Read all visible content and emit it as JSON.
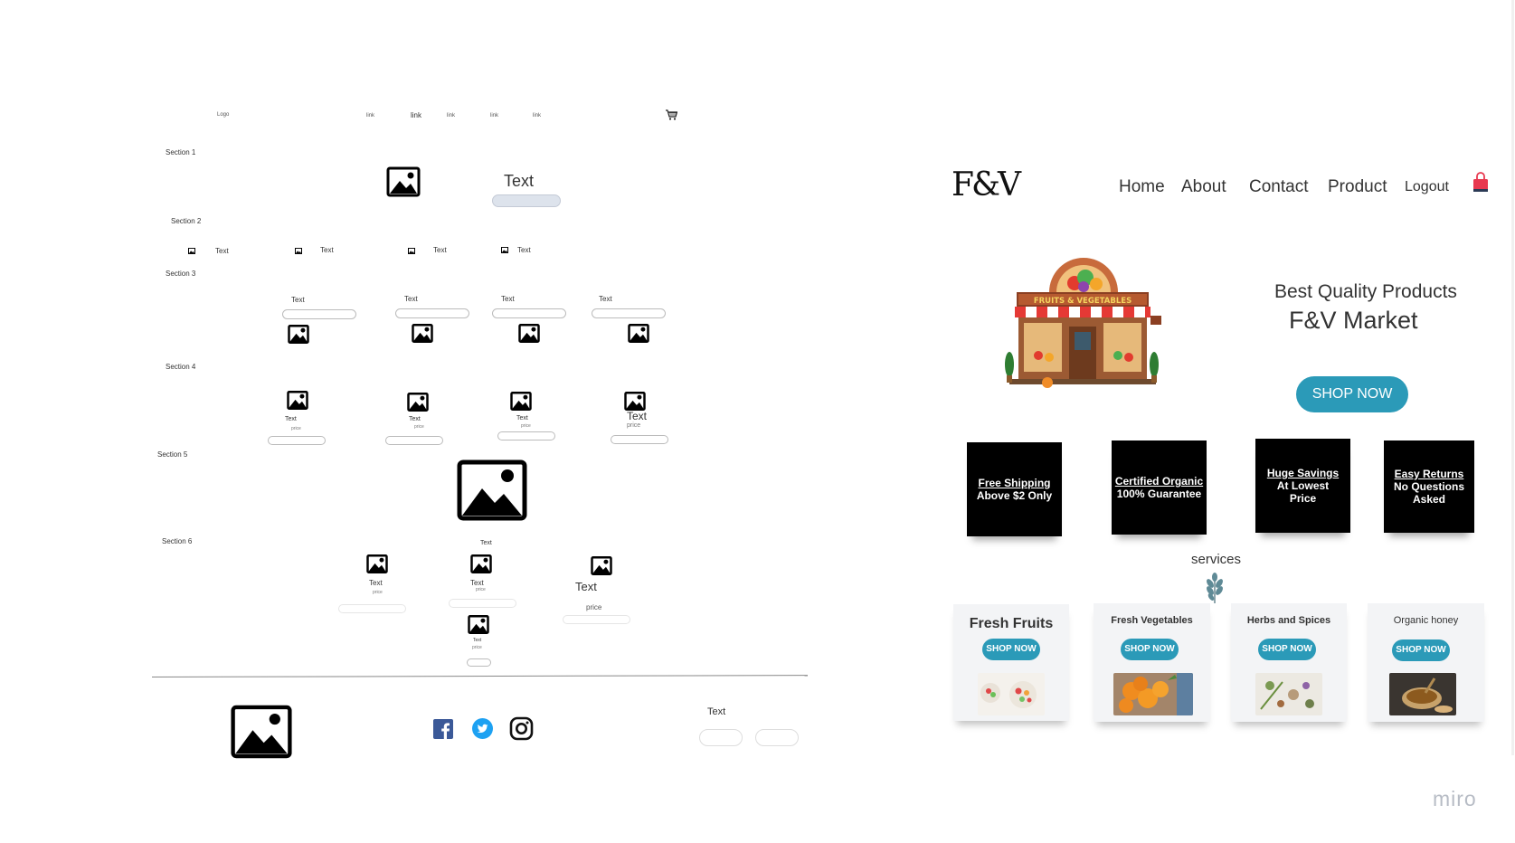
{
  "wireframe": {
    "logo": "Logo",
    "nav_links": [
      "link",
      "link",
      "link",
      "link",
      "link"
    ],
    "cart_icon": "cart-icon",
    "sections": [
      "Section 1",
      "Section 2",
      "Section 3",
      "Section 4",
      "Section 5",
      "Section 6"
    ],
    "section1": {
      "text": "Text"
    },
    "section2": {
      "items": [
        "Text",
        "Text",
        "Text",
        "Text"
      ]
    },
    "section3": {
      "items": [
        "Text",
        "Text",
        "Text",
        "Text"
      ]
    },
    "section4": {
      "items": [
        {
          "text": "Text",
          "price": "price"
        },
        {
          "text": "Text",
          "price": "price"
        },
        {
          "text": "Text",
          "price": "price"
        },
        {
          "text": "Text",
          "price": "price"
        }
      ]
    },
    "section6": {
      "top_text": "Text",
      "items": [
        {
          "text": "Text",
          "price": "price"
        },
        {
          "text": "Text",
          "price": "price"
        },
        {
          "text": "Text",
          "price": "price"
        },
        {
          "text": "Text",
          "price": "price"
        }
      ]
    },
    "footer": {
      "text": "Text",
      "social_icons": [
        "facebook-icon",
        "twitter-icon",
        "instagram-icon"
      ]
    }
  },
  "mockup": {
    "logo": "F&V",
    "nav": {
      "home": "Home",
      "about": "About",
      "contact": "Contact",
      "product": "Product",
      "logout": "Logout"
    },
    "hero": {
      "tagline": "Best Quality Products",
      "title": "F&V Market",
      "button": "SHOP NOW",
      "store_sign": "FRUITS & VEGETABLES"
    },
    "features": [
      {
        "line1": "Free Shipping",
        "line2": "Above $2 Only",
        "line3": ""
      },
      {
        "line1": "Certified Organic",
        "line2": "100% Guarantee",
        "line3": ""
      },
      {
        "line1": "Huge Savings",
        "line2": "At Lowest",
        "line3": "Price"
      },
      {
        "line1": "Easy Returns",
        "line2": "No Questions",
        "line3": "Asked"
      }
    ],
    "services_label": "services",
    "services": [
      {
        "title": "Fresh Fruits",
        "button": "SHOP NOW"
      },
      {
        "title": "Fresh Vegetables",
        "button": "SHOP NOW"
      },
      {
        "title": "Herbs and Spices",
        "button": "SHOP NOW"
      },
      {
        "title": "Organic honey",
        "button": "SHOP NOW"
      }
    ],
    "colors": {
      "accent": "#2b9ab8",
      "feature_bg": "#000000",
      "card_bg": "#f3f4f6"
    }
  },
  "watermark": "miro"
}
